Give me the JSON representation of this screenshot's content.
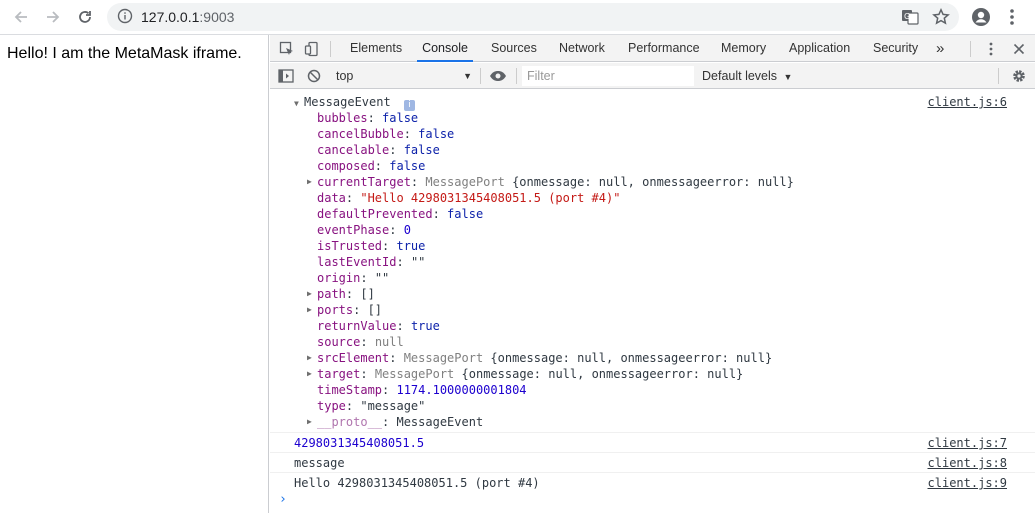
{
  "browser": {
    "url_host": "127.0.0.1",
    "url_port": ":9003"
  },
  "page": {
    "text": "Hello! I am the MetaMask iframe."
  },
  "devtools": {
    "tabs": [
      "Elements",
      "Console",
      "Sources",
      "Network",
      "Performance",
      "Memory",
      "Application",
      "Security"
    ],
    "more": "»",
    "context": "top",
    "filter_placeholder": "Filter",
    "levels": "Default levels",
    "levels_arrow": "▼",
    "context_arrow": "▼"
  },
  "console": {
    "event_label": "MessageEvent",
    "event_src": "client.js:6",
    "props": [
      {
        "key": "bubbles",
        "value": "false",
        "kind": "b",
        "expand": false
      },
      {
        "key": "cancelBubble",
        "value": "false",
        "kind": "b",
        "expand": false
      },
      {
        "key": "cancelable",
        "value": "false",
        "kind": "b",
        "expand": false
      },
      {
        "key": "composed",
        "value": "false",
        "kind": "b",
        "expand": false
      },
      {
        "key": "currentTarget",
        "value": "MessagePort {onmessage: null, onmessageerror: null}",
        "kind": "obj",
        "expand": true
      },
      {
        "key": "data",
        "value": "\"Hello 4298031345408051.5 (port #4)\"",
        "kind": "s",
        "expand": false
      },
      {
        "key": "defaultPrevented",
        "value": "false",
        "kind": "b",
        "expand": false
      },
      {
        "key": "eventPhase",
        "value": "0",
        "kind": "n",
        "expand": false
      },
      {
        "key": "isTrusted",
        "value": "true",
        "kind": "b",
        "expand": false
      },
      {
        "key": "lastEventId",
        "value": "\"\"",
        "kind": "d",
        "expand": false
      },
      {
        "key": "origin",
        "value": "\"\"",
        "kind": "d",
        "expand": false
      },
      {
        "key": "path",
        "value": "[]",
        "kind": "d",
        "expand": true
      },
      {
        "key": "ports",
        "value": "[]",
        "kind": "d",
        "expand": true
      },
      {
        "key": "returnValue",
        "value": "true",
        "kind": "b",
        "expand": false
      },
      {
        "key": "source",
        "value": "null",
        "kind": "g",
        "expand": false
      },
      {
        "key": "srcElement",
        "value": "MessagePort {onmessage: null, onmessageerror: null}",
        "kind": "obj",
        "expand": true
      },
      {
        "key": "target",
        "value": "MessagePort {onmessage: null, onmessageerror: null}",
        "kind": "obj",
        "expand": true
      },
      {
        "key": "timeStamp",
        "value": "1174.1000000001804",
        "kind": "n",
        "expand": false
      },
      {
        "key": "type",
        "value": "\"message\"",
        "kind": "d",
        "expand": false
      },
      {
        "key": "__proto__",
        "value": "MessageEvent",
        "kind": "proto",
        "expand": true
      }
    ],
    "messages": [
      {
        "text": "4298031345408051.5",
        "src": "client.js:7",
        "kind": "n"
      },
      {
        "text": "message",
        "src": "client.js:8",
        "kind": "d"
      },
      {
        "text": "Hello 4298031345408051.5 (port #4)",
        "src": "client.js:9",
        "kind": "d"
      }
    ],
    "prompt": "›"
  }
}
